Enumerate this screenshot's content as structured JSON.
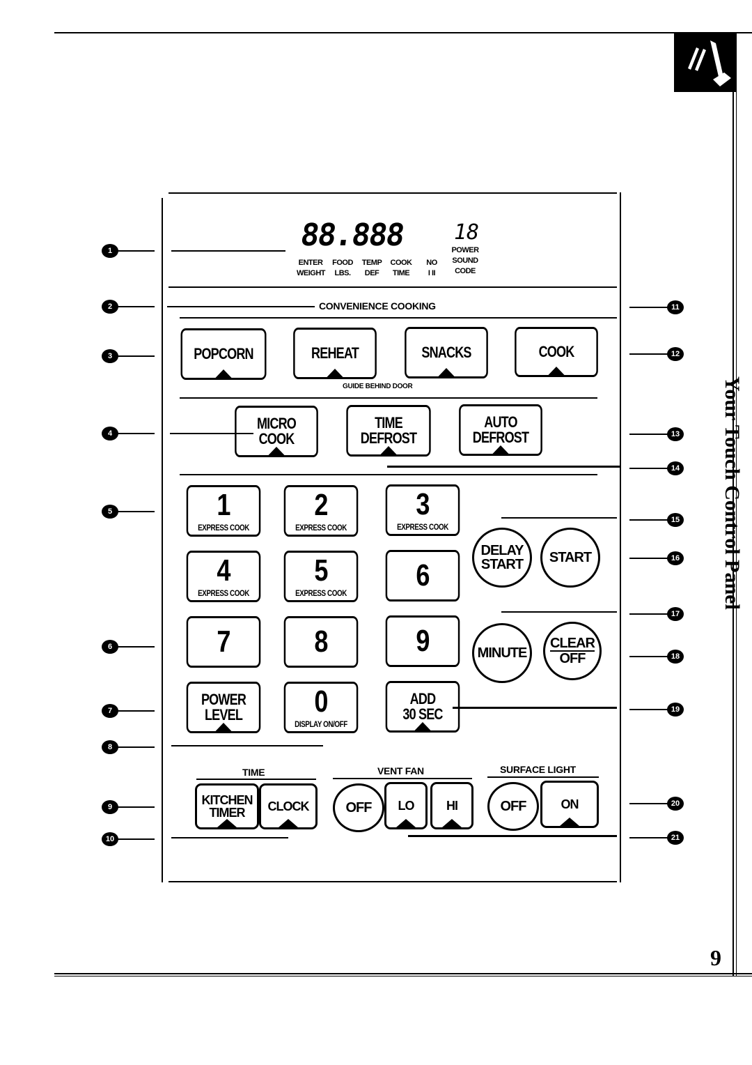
{
  "page": {
    "side_title": "Your Touch Control Panel",
    "page_number": "9",
    "corner_icon": "hand-pressing-button-icon"
  },
  "display": {
    "digits": "88.888",
    "power_digits": "18",
    "indicator_labels": [
      {
        "top": "ENTER",
        "bottom": "WEIGHT"
      },
      {
        "top": "FOOD",
        "bottom": "LBS."
      },
      {
        "top": "TEMP",
        "bottom": "DEF"
      },
      {
        "top": "COOK",
        "bottom": "TIME"
      },
      {
        "top": "NO",
        "bottom": "I II"
      },
      {
        "top": "POWER",
        "middle": "SOUND",
        "bottom": "CODE"
      }
    ]
  },
  "sections": {
    "convenience": "CONVENIENCE COOKING",
    "guide": "GUIDE BEHIND DOOR",
    "time": "TIME",
    "vent_fan": "VENT FAN",
    "surface_light": "SURFACE LIGHT"
  },
  "keys": {
    "popcorn": "POPCORN",
    "reheat": "REHEAT",
    "snacks": "SNACKS",
    "cook": "COOK",
    "micro_cook": [
      "MICRO",
      "COOK"
    ],
    "time_defrost": [
      "TIME",
      "DEFROST"
    ],
    "auto_defrost": [
      "AUTO",
      "DEFROST"
    ],
    "express_cook": "EXPRESS COOK",
    "digits": [
      "1",
      "2",
      "3",
      "4",
      "5",
      "6",
      "7",
      "8",
      "9",
      "0"
    ],
    "display_onoff": "DISPLAY ON/OFF",
    "power_level": [
      "POWER",
      "LEVEL"
    ],
    "add_30": [
      "ADD",
      "30 SEC"
    ],
    "delay_start": [
      "DELAY",
      "START"
    ],
    "start": "START",
    "minute": "MINUTE",
    "clear_off": [
      "CLEAR",
      "OFF"
    ],
    "kitchen_timer": [
      "KITCHEN",
      "TIMER"
    ],
    "clock": "CLOCK",
    "fan_off": "OFF",
    "fan_lo": "LO",
    "fan_hi": "HI",
    "light_off": "OFF",
    "light_on": "ON"
  },
  "callouts": [
    "1",
    "2",
    "3",
    "4",
    "5",
    "6",
    "7",
    "8",
    "9",
    "10",
    "11",
    "12",
    "13",
    "14",
    "15",
    "16",
    "17",
    "18",
    "19",
    "20",
    "21"
  ]
}
